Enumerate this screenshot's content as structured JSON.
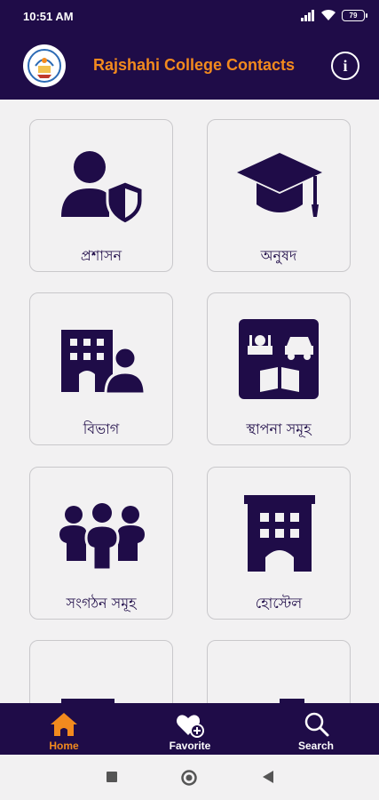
{
  "status_bar": {
    "time": "10:51 AM",
    "battery": "79"
  },
  "app_bar": {
    "title": "Rajshahi College Contacts",
    "info_icon": "info-icon"
  },
  "cards": [
    {
      "label": "প্রশাসন",
      "icon": "admin-shield-user-icon"
    },
    {
      "label": "অনুষদ",
      "icon": "graduation-cap-icon"
    },
    {
      "label": "বিভাগ",
      "icon": "department-building-icon"
    },
    {
      "label": "স্থাপনা সমূহ",
      "icon": "establishments-icon"
    },
    {
      "label": "সংগঠন সমূহ",
      "icon": "organizations-group-icon"
    },
    {
      "label": "হোস্টেল",
      "icon": "hostel-building-icon"
    },
    {
      "label": "",
      "icon": "ambulance-icon"
    },
    {
      "label": "",
      "icon": "city-person-icon"
    }
  ],
  "bottom_nav": [
    {
      "label": "Home",
      "icon": "home-icon",
      "active": true
    },
    {
      "label": "Favorite",
      "icon": "favorite-add-icon",
      "active": false
    },
    {
      "label": "Search",
      "icon": "search-icon",
      "active": false
    }
  ],
  "colors": {
    "primary": "#1f0c48",
    "accent": "#f28a1e",
    "background": "#f2f1f2"
  }
}
